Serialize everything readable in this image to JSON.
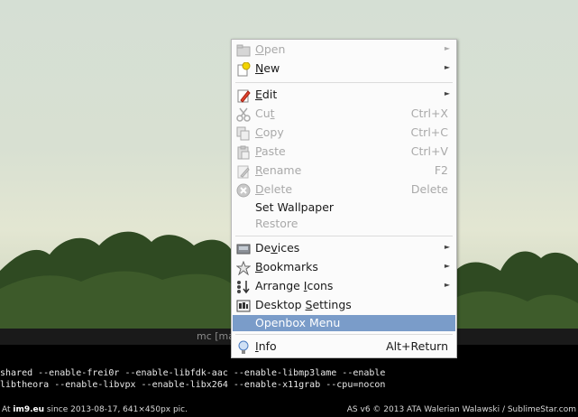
{
  "menu": {
    "items": [
      {
        "label": "Open",
        "mnemonic": "O",
        "rest": "pen",
        "shortcut": "",
        "submenu": true,
        "disabled": true,
        "icon": "folder-open-icon"
      },
      {
        "label": "New",
        "mnemonic": "N",
        "rest": "ew",
        "shortcut": "",
        "submenu": true,
        "disabled": false,
        "icon": "new-document-icon"
      },
      {
        "label": "Edit",
        "mnemonic": "E",
        "rest": "dit",
        "shortcut": "",
        "submenu": true,
        "disabled": false,
        "icon": "edit-icon"
      },
      {
        "label": "Cut",
        "pre": "Cu",
        "mnemonic": "t",
        "rest": "",
        "shortcut": "Ctrl+X",
        "submenu": false,
        "disabled": true,
        "icon": "scissors-icon"
      },
      {
        "label": "Copy",
        "mnemonic": "C",
        "rest": "opy",
        "shortcut": "Ctrl+C",
        "submenu": false,
        "disabled": true,
        "icon": "copy-icon"
      },
      {
        "label": "Paste",
        "mnemonic": "P",
        "rest": "aste",
        "shortcut": "Ctrl+V",
        "submenu": false,
        "disabled": true,
        "icon": "paste-icon"
      },
      {
        "label": "Rename",
        "mnemonic": "R",
        "rest": "ename",
        "shortcut": "F2",
        "submenu": false,
        "disabled": true,
        "icon": "rename-icon"
      },
      {
        "label": "Delete",
        "mnemonic": "D",
        "rest": "elete",
        "shortcut": "Delete",
        "submenu": false,
        "disabled": true,
        "icon": "delete-icon"
      },
      {
        "label": "Set Wallpaper",
        "shortcut": "",
        "submenu": false,
        "disabled": false,
        "icon": ""
      },
      {
        "label": "Restore",
        "shortcut": "",
        "submenu": false,
        "disabled": true,
        "icon": ""
      },
      {
        "label": "Devices",
        "pre": "De",
        "mnemonic": "v",
        "rest": "ices",
        "shortcut": "",
        "submenu": true,
        "disabled": false,
        "icon": "devices-icon"
      },
      {
        "label": "Bookmarks",
        "mnemonic": "B",
        "rest": "ookmarks",
        "shortcut": "",
        "submenu": true,
        "disabled": false,
        "icon": "bookmarks-icon"
      },
      {
        "label": "Arrange Icons",
        "pre": "Arrange ",
        "mnemonic": "I",
        "rest": "cons",
        "shortcut": "",
        "submenu": true,
        "disabled": false,
        "icon": "arrange-icons-icon"
      },
      {
        "label": "Desktop Settings",
        "pre": "Desktop ",
        "mnemonic": "S",
        "rest": "ettings",
        "shortcut": "",
        "submenu": false,
        "disabled": false,
        "icon": "settings-icon"
      },
      {
        "label": "Openbox Menu",
        "shortcut": "",
        "submenu": false,
        "disabled": false,
        "selected": true,
        "icon": ""
      },
      {
        "label": "Info",
        "mnemonic": "I",
        "rest": "nfo",
        "shortcut": "Alt+Return",
        "submenu": false,
        "disabled": false,
        "icon": "info-icon"
      }
    ]
  },
  "terminal": {
    "title": "mc [ma",
    "line1": "shared --enable-frei0r --enable-libfdk-aac --enable-libmp3lame --enable",
    "line2": "libtheora --enable-libvpx --enable-libx264 --enable-x11grab --cpu=nocon"
  },
  "footer": {
    "left_prefix": "At ",
    "left_site": "im9.eu",
    "left_rest": " since 2013-08-17, 641×450px pic.",
    "right": "AS v6 © 2013 ATA Walerian Walawski / SublimeStar.com"
  },
  "colors": {
    "selection": "#7a9cc9",
    "disabled_text": "#a9a9a9"
  }
}
